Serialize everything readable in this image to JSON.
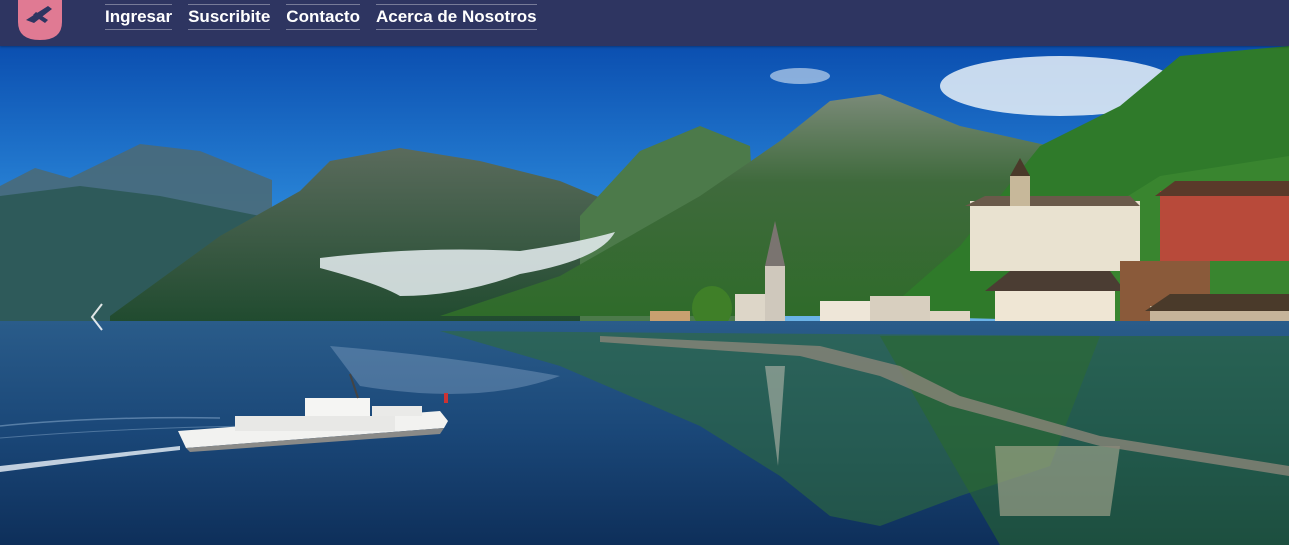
{
  "navbar": {
    "logo": "plane-logo-icon",
    "links": [
      {
        "label": "Ingresar"
      },
      {
        "label": "Suscribite"
      },
      {
        "label": "Contacto"
      },
      {
        "label": "Acerca de Nosotros"
      }
    ]
  },
  "hero": {
    "image": "lakeside-alpine-village-photo",
    "prev_icon": "chevron-left-icon"
  },
  "colors": {
    "navbar_bg": "#2e3561",
    "logo_pink": "#e07a93",
    "logo_plane": "#2e3561"
  }
}
